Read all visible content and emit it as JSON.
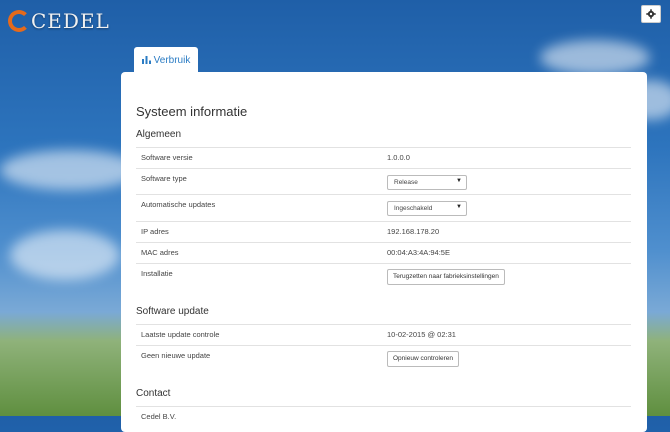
{
  "brand": {
    "name": "CEDEL"
  },
  "nav": {
    "tab_label": "Verbruik"
  },
  "panel": {
    "title": "Systeem informatie",
    "general": {
      "heading": "Algemeen",
      "software_version": {
        "label": "Software versie",
        "value": "1.0.0.0"
      },
      "software_type": {
        "label": "Software type",
        "selected": "Release"
      },
      "auto_updates": {
        "label": "Automatische updates",
        "selected": "Ingeschakeld"
      },
      "ip": {
        "label": "IP adres",
        "value": "192.168.178.20"
      },
      "mac": {
        "label": "MAC adres",
        "value": "00:04:A3:4A:94:5E"
      },
      "install": {
        "label": "Installatie",
        "button": "Terugzetten naar fabrieksinstellingen"
      }
    },
    "software_update": {
      "heading": "Software update",
      "last_check": {
        "label": "Laatste update controle",
        "value": "10-02-2015 @ 02:31"
      },
      "status": {
        "label": "Geen nieuwe update",
        "button": "Opnieuw controleren"
      }
    },
    "contact": {
      "heading": "Contact",
      "company": "Cedel B.V."
    }
  },
  "colors": {
    "accent": "#2b7cc4",
    "logo_orange": "#e56a1c"
  },
  "icons": {
    "settings": "gear-icon",
    "tab": "bar-chart-icon"
  }
}
